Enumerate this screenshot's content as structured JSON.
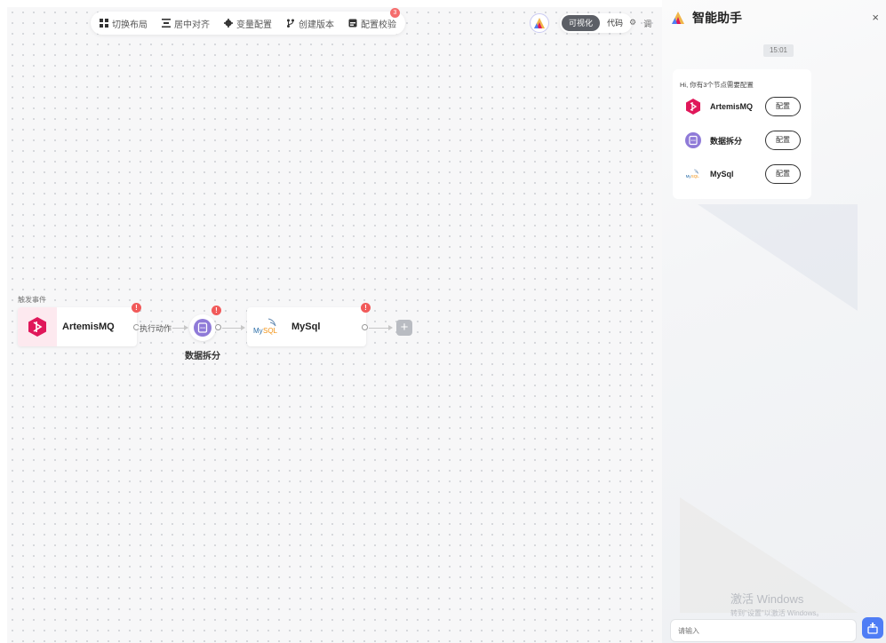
{
  "toolbar": {
    "items": [
      {
        "label": "切换布局",
        "icon": "layout-icon"
      },
      {
        "label": "居中对齐",
        "icon": "align-center-icon"
      },
      {
        "label": "变量配置",
        "icon": "gear-icon"
      },
      {
        "label": "创建版本",
        "icon": "branch-icon"
      },
      {
        "label": "配置校验",
        "icon": "check-icon",
        "badge": "3"
      }
    ]
  },
  "view_switch": {
    "visual": "可视化",
    "code": "代码"
  },
  "right_tools": [
    "⚙",
    "调"
  ],
  "flow": {
    "trigger_label": "触发事件",
    "edge_label": "执行动作",
    "nodes": [
      {
        "label": "ArtemisMQ",
        "icon": "artemis-icon",
        "error": "!"
      },
      {
        "label": "数据拆分",
        "icon": "data-split-icon",
        "error": "!"
      },
      {
        "label": "MySql",
        "icon": "mysql-icon",
        "error": "!"
      }
    ],
    "add_label": "+"
  },
  "assistant": {
    "title": "智能助手",
    "close": "×",
    "time": "15:01",
    "message": "Hi, 你有3个节点需要配置",
    "items": [
      {
        "label": "ArtemisMQ",
        "button": "配置",
        "icon": "artemis-icon"
      },
      {
        "label": "数据拆分",
        "button": "配置",
        "icon": "data-split-icon"
      },
      {
        "label": "MySql",
        "button": "配置",
        "icon": "mysql-icon"
      }
    ],
    "input_placeholder": "请输入"
  },
  "watermark": {
    "line1": "激活 Windows",
    "line2": "转到\"设置\"以激活 Windows。"
  },
  "colors": {
    "accent": "#4f7df5",
    "error": "#f15a5a",
    "artemis": "#e0175a",
    "split": "#8f7ad8",
    "active_switch": "#5c5f66"
  }
}
